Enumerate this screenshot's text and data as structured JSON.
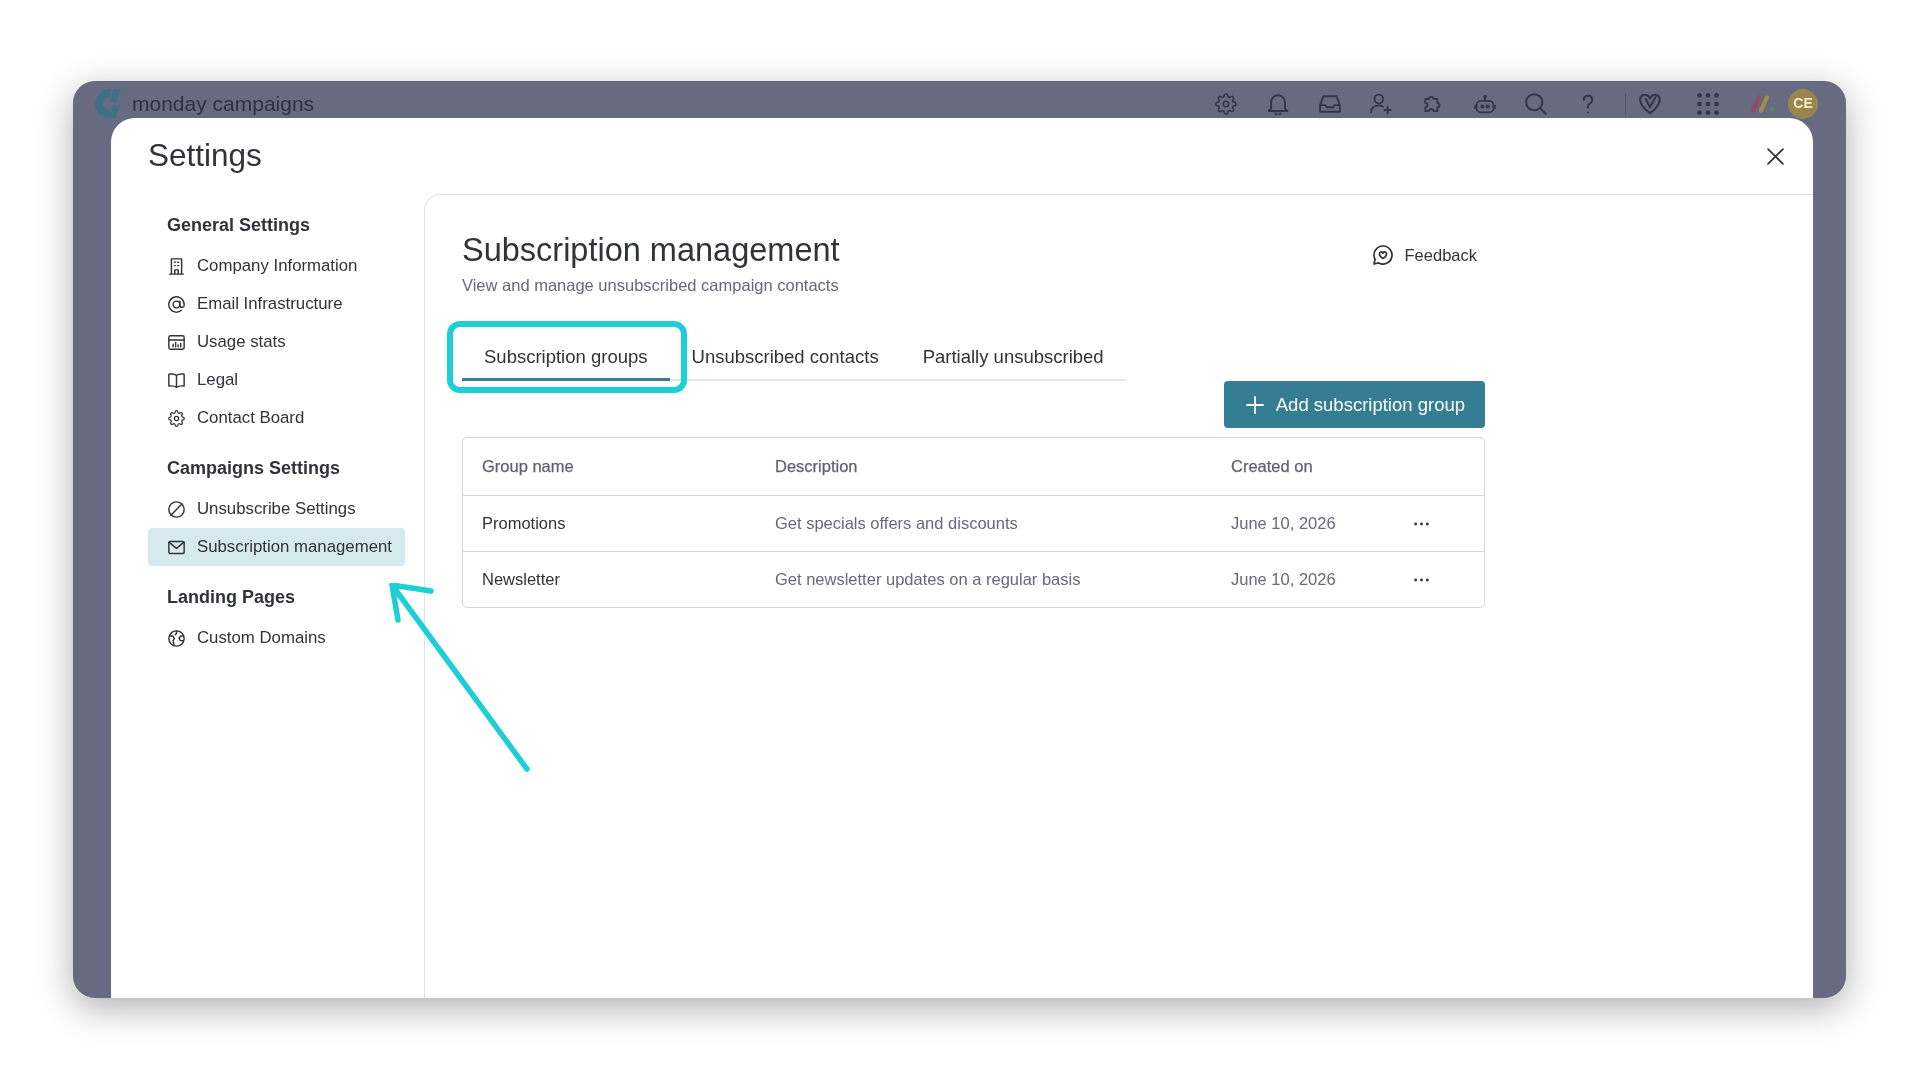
{
  "top_bar": {
    "brand": "**monday** campaigns",
    "avatar": "CE"
  },
  "modal": {
    "title": "Settings"
  },
  "sidebar": {
    "groups": [
      {
        "heading": "General Settings",
        "items": [
          {
            "label": "Company Information",
            "selected": false
          },
          {
            "label": "Email Infrastructure",
            "selected": false
          },
          {
            "label": "Usage stats",
            "selected": false
          },
          {
            "label": "Legal",
            "selected": false
          },
          {
            "label": "Contact Board",
            "selected": false
          }
        ]
      },
      {
        "heading": "Campaigns Settings",
        "items": [
          {
            "label": "Unsubscribe Settings",
            "selected": false
          },
          {
            "label": "Subscription management",
            "selected": true
          }
        ]
      },
      {
        "heading": "Landing Pages",
        "items": [
          {
            "label": "Custom Domains",
            "selected": false
          }
        ]
      }
    ]
  },
  "content": {
    "title": "Subscription management",
    "subtitle": "View and manage unsubscribed campaign contacts",
    "feedback": "Feedback",
    "tabs": [
      {
        "label": "Subscription groups",
        "selected": true
      },
      {
        "label": "Unsubscribed contacts",
        "selected": false
      },
      {
        "label": "Partially unsubscribed",
        "selected": false
      }
    ],
    "add_button": "Add subscription group",
    "table": {
      "columns": [
        "Group name",
        "Description",
        "Created on"
      ],
      "rows": [
        {
          "group_name": "Promotions",
          "description": "Get specials offers and discounts",
          "created_on": "June 10, 2026"
        },
        {
          "group_name": "Newsletter",
          "description": "Get newsletter updates on a regular basis",
          "created_on": "June 10, 2026"
        }
      ]
    }
  }
}
